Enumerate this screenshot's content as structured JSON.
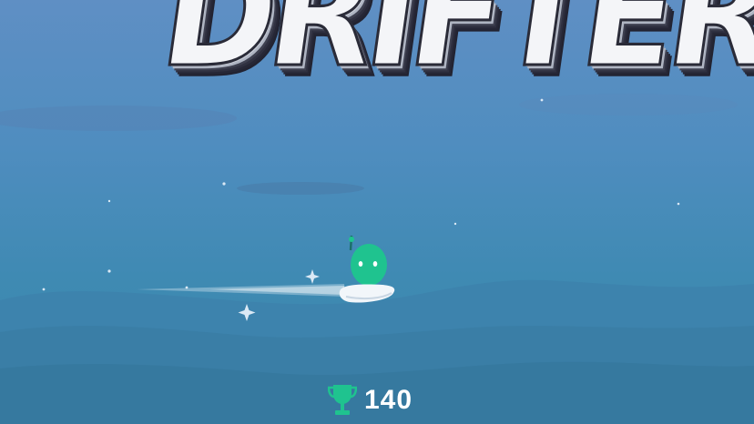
{
  "game": {
    "title": "DRIFTERS",
    "score": "140",
    "colors": {
      "sky_top": "#5f8fc4",
      "sky_bottom": "#3b86a8",
      "accent_green": "#1fc38f",
      "title_fill": "#f4f5f8"
    },
    "icons": {
      "score_icon": "trophy-icon",
      "player": "green-alien-on-hoverboard"
    }
  }
}
